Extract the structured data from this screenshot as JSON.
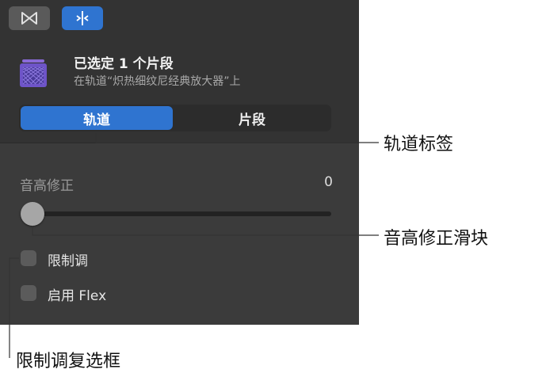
{
  "toolbar": {
    "buttons": [
      {
        "icon": "smart-controls-icon",
        "active": false
      },
      {
        "icon": "editor-icon",
        "active": true
      }
    ]
  },
  "selection": {
    "icon": "amp-icon",
    "title": "已选定 1 个片段",
    "subtitle": "在轨道“炽热细纹尼经典放大器”上"
  },
  "segmented": {
    "track_label": "轨道",
    "region_label": "片段",
    "selected": "轨道"
  },
  "pitch": {
    "label": "音高修正",
    "value": "0",
    "slider_fraction": 0
  },
  "checkboxes": {
    "limit_label": "限制调",
    "flex_label": "启用 Flex"
  },
  "callouts": {
    "track_tab": "轨道标签",
    "pitch_slider": "音高修正滑块",
    "limit_checkbox": "限制调复选框"
  },
  "colors": {
    "accent": "#2f74d0",
    "panel": "#3b3b3b"
  }
}
